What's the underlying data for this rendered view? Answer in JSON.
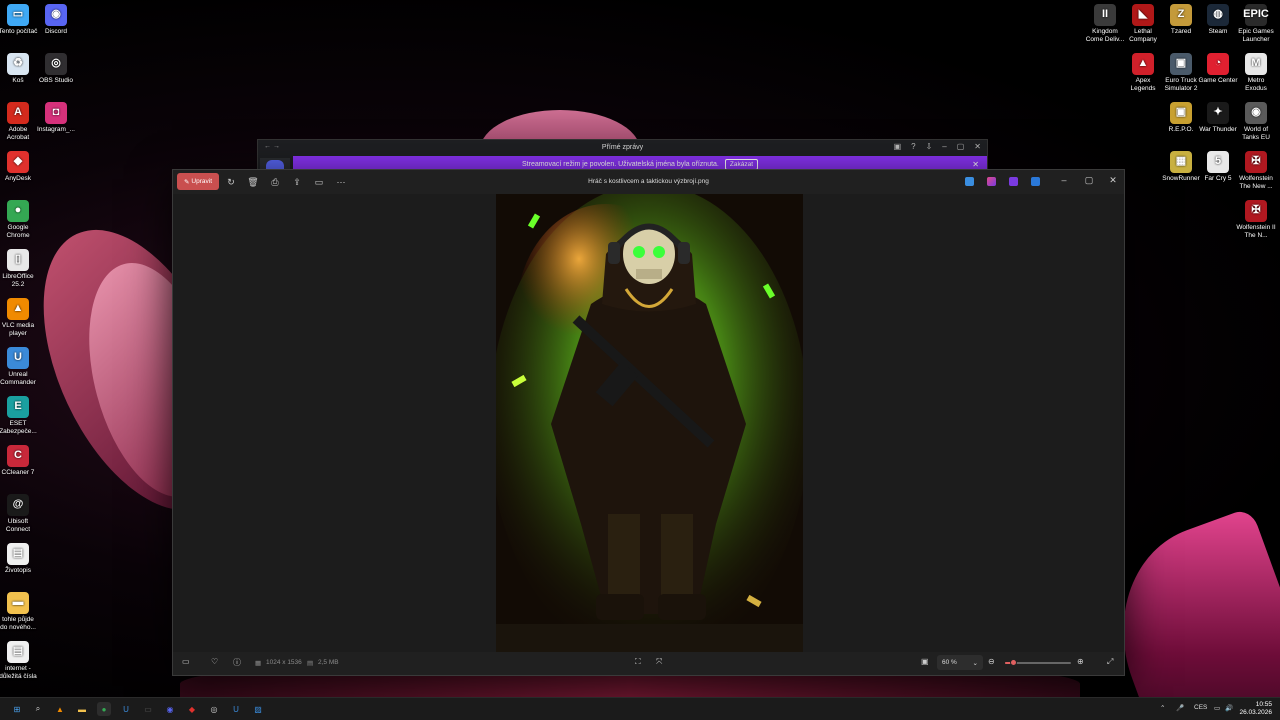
{
  "desktop_left": [
    {
      "label": "Tento počítač",
      "icon": "computer-icon",
      "color": "#3fa9f5",
      "glyph": "▭"
    },
    {
      "label": "Discord",
      "icon": "discord-icon",
      "color": "#5865f2",
      "glyph": "◉"
    },
    {
      "label": "Koš",
      "icon": "recycle-bin-icon",
      "color": "#d9e6f2",
      "glyph": "♻"
    },
    {
      "label": "OBS Studio",
      "icon": "obs-icon",
      "color": "#302e31",
      "glyph": "◎"
    },
    {
      "label": "Adobe Acrobat",
      "icon": "acrobat-icon",
      "color": "#d42a1d",
      "glyph": "A"
    },
    {
      "label": "Instagram_...",
      "icon": "instagram-icon",
      "color": "#d6317b",
      "glyph": "◘"
    },
    {
      "label": "AnyDesk",
      "icon": "anydesk-icon",
      "color": "#e0312d",
      "glyph": "◆"
    },
    {
      "label": "Google Chrome",
      "icon": "chrome-icon",
      "color": "#34a853",
      "glyph": "●"
    },
    {
      "label": "LibreOffice 25.2",
      "icon": "libreoffice-icon",
      "color": "#e8e8e8",
      "glyph": "▯"
    },
    {
      "label": "VLC media player",
      "icon": "vlc-icon",
      "color": "#f08a00",
      "glyph": "▲"
    },
    {
      "label": "Unreal Commander",
      "icon": "unreal-commander-icon",
      "color": "#3b8ad9",
      "glyph": "U"
    },
    {
      "label": "ESET Zabezpeče...",
      "icon": "eset-icon",
      "color": "#1aa0a0",
      "glyph": "E"
    },
    {
      "label": "CCleaner 7",
      "icon": "ccleaner-icon",
      "color": "#c8283a",
      "glyph": "C"
    },
    {
      "label": "Ubisoft Connect",
      "icon": "ubisoft-icon",
      "color": "#1a1a1a",
      "glyph": "@"
    },
    {
      "label": "Životopis",
      "icon": "document-icon",
      "color": "#f0f0f0",
      "glyph": "▤"
    },
    {
      "label": "tohle půjde do nového...",
      "icon": "folder-icon",
      "color": "#f2c14e",
      "glyph": "▬"
    },
    {
      "label": "internet - důležitá čísla",
      "icon": "text-file-icon",
      "color": "#f0f0f0",
      "glyph": "▤"
    }
  ],
  "desktop_right": [
    {
      "label": "Kingdom Come Deliv...",
      "icon": "kingdom-come-icon",
      "color": "#3a3a3a",
      "glyph": "II"
    },
    {
      "label": "Lethal Company",
      "icon": "lethal-company-icon",
      "color": "#b01818",
      "glyph": "◣"
    },
    {
      "label": "Tzared",
      "icon": "tzared-icon",
      "color": "#c49a3a",
      "glyph": "Z"
    },
    {
      "label": "Steam",
      "icon": "steam-icon",
      "color": "#1b2838",
      "glyph": "◍"
    },
    {
      "label": "Epic Games Launcher",
      "icon": "epic-games-icon",
      "color": "#2a2a2a",
      "glyph": "EPIC"
    },
    {
      "label": "Apex Legends",
      "icon": "apex-legends-icon",
      "color": "#d0202a",
      "glyph": "▲"
    },
    {
      "label": "Euro Truck Simulator 2",
      "icon": "euro-truck-icon",
      "color": "#4a5a6a",
      "glyph": "▣"
    },
    {
      "label": "Game Center",
      "icon": "game-center-icon",
      "color": "#e02030",
      "glyph": "◔"
    },
    {
      "label": "Metro Exodus",
      "icon": "metro-exodus-icon",
      "color": "#e8e8e8",
      "glyph": "M"
    },
    {
      "label": "R.E.P.O.",
      "icon": "repo-icon",
      "color": "#c8a030",
      "glyph": "▣"
    },
    {
      "label": "War Thunder",
      "icon": "war-thunder-icon",
      "color": "#1a1a1a",
      "glyph": "✦"
    },
    {
      "label": "World of Tanks EU",
      "icon": "world-of-tanks-icon",
      "color": "#5a5a5a",
      "glyph": "◉"
    },
    {
      "label": "SnowRunner",
      "icon": "snowrunner-icon",
      "color": "#c8b040",
      "glyph": "▦"
    },
    {
      "label": "Far Cry 5",
      "icon": "far-cry-5-icon",
      "color": "#e8e8e8",
      "glyph": "5"
    },
    {
      "label": "Wolfenstein The New ...",
      "icon": "wolfenstein-icon",
      "color": "#b01820",
      "glyph": "✠"
    },
    {
      "label": "Wolfenstein II The N...",
      "icon": "wolfenstein-2-icon",
      "color": "#b01820",
      "glyph": "✠"
    }
  ],
  "discord_window": {
    "title": "Přímé zprávy",
    "banner_text": "Streamovací režim je povolen. Uživatelská jména byla oříznuta.",
    "banner_button": "Zakázat"
  },
  "photos_window": {
    "edit_label": "Upravit",
    "file_title": "Hráč s kostlivcem a taktickou výzbrojí.png",
    "dimensions": "1024 x 1536",
    "file_size": "2,5 MB",
    "zoom": "60 %",
    "zoom_fraction": 0.12
  },
  "taskbar": {
    "language": "CES",
    "time": "10:55",
    "date": "26.03.2026"
  },
  "colors": {
    "accent_red": "#c94f4f",
    "discord_purple": "#8a33f5",
    "window_bg": "#202020"
  }
}
